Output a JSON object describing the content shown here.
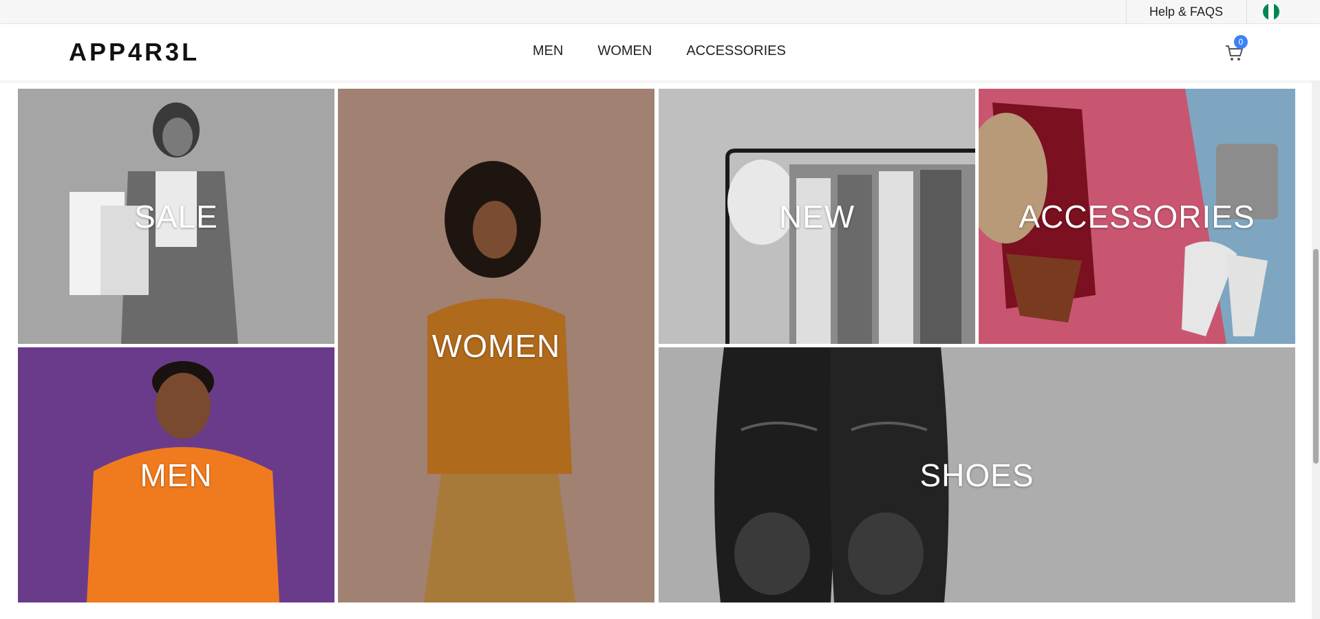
{
  "topbar": {
    "help_label": "Help & FAQS",
    "flag_icon": "nigeria-flag-icon",
    "flag_colors": [
      "#008751",
      "#ffffff",
      "#008751"
    ]
  },
  "header": {
    "logo": "APP4R3L",
    "nav": [
      {
        "label": "MEN"
      },
      {
        "label": "WOMEN"
      },
      {
        "label": "ACCESSORIES"
      }
    ],
    "cart": {
      "icon": "cart-icon",
      "count": "0",
      "badge_color": "#3b82f6"
    }
  },
  "categories": [
    {
      "label": "SALE"
    },
    {
      "label": "WOMEN"
    },
    {
      "label": "NEW"
    },
    {
      "label": "ACCESSORIES"
    },
    {
      "label": "MEN"
    },
    {
      "label": "SHOES"
    }
  ],
  "colors": {
    "sale_bg": "#9a9a9a",
    "women_bg": "#a2806f",
    "new_bg": "#bdbdbd",
    "accessories_bg": "#c9576e",
    "men_bg": "#6b3a8c",
    "shoes_bg": "#adadad"
  }
}
